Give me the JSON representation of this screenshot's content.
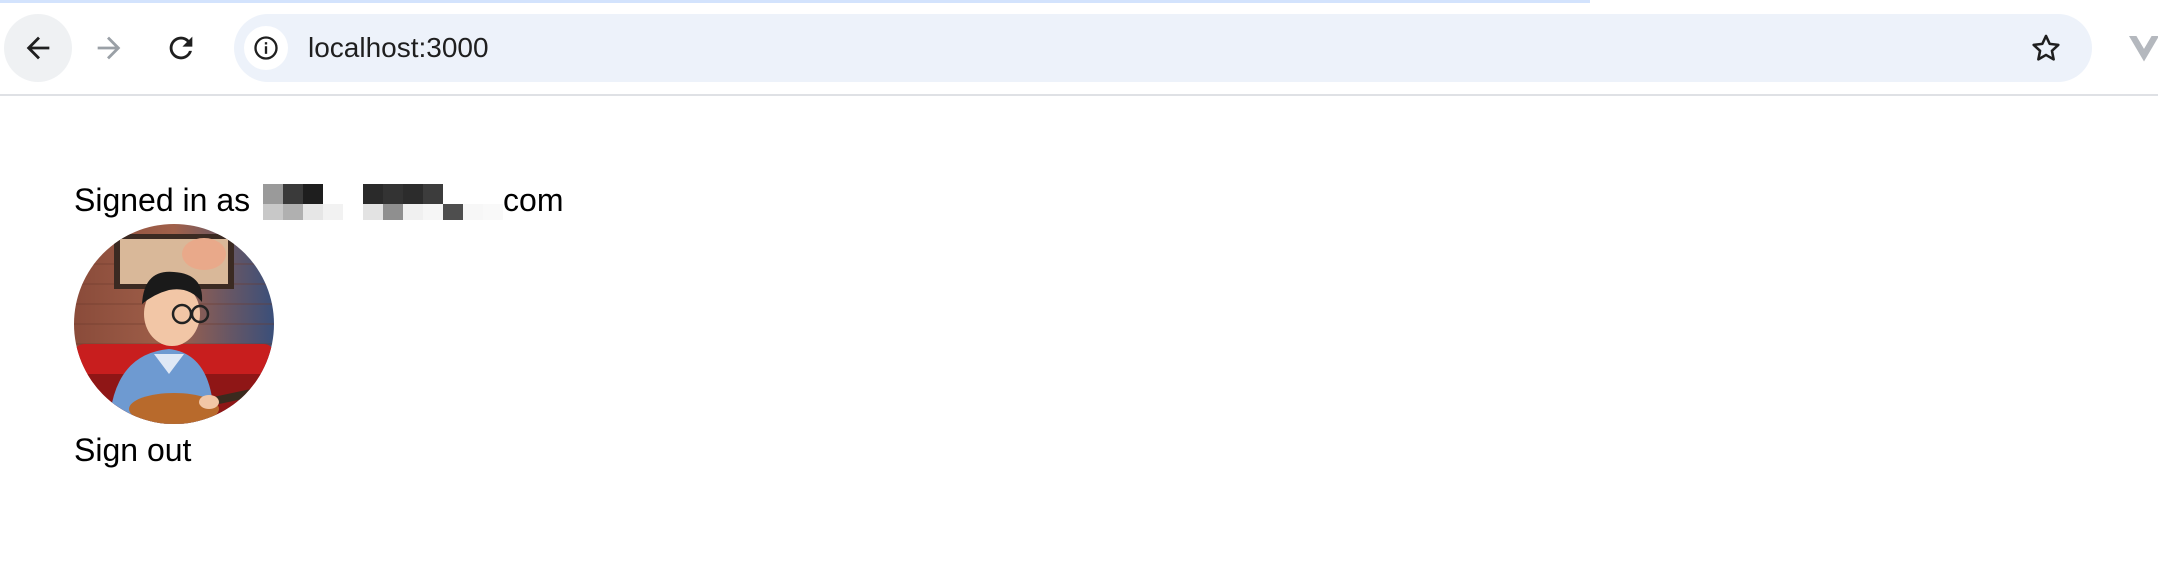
{
  "browser": {
    "url": "localhost:3000",
    "icons": {
      "back": "arrow-left-icon",
      "forward": "arrow-right-icon",
      "reload": "reload-icon",
      "site_info": "info-icon",
      "bookmark": "star-icon",
      "extension": "vuejs-devtools-icon"
    }
  },
  "page": {
    "signed_in_prefix": "Signed in as ",
    "email_visible_suffix": "com",
    "email_redacted": true,
    "sign_out_label": "Sign out"
  },
  "colors": {
    "omnibox_bg": "#edf2fa",
    "toolbar_border": "#dfe1e5",
    "text": "#000000"
  }
}
